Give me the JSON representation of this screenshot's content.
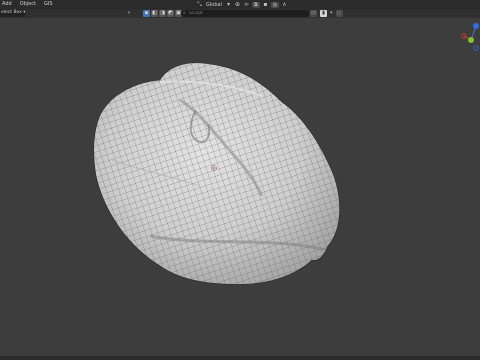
{
  "menubar": {
    "items": [
      "Add",
      "Object",
      "GIS"
    ]
  },
  "header": {
    "pivot_label": "Global",
    "snap_dropdown": "▾"
  },
  "toolbar": {
    "select_mode_label": "elect Box ▾",
    "collapse_glyph": "«",
    "search_placeholder": "Sculpt"
  },
  "gizmo": {
    "axes": [
      {
        "name": "Z",
        "color": "#2f6fe0"
      },
      {
        "name": "X",
        "color": "#e0362f"
      },
      {
        "name": "Y",
        "color": "#86c234"
      }
    ]
  },
  "colors": {
    "background": "#3d3d3d",
    "menubar": "#2b2b2b",
    "active_tool": "#4772b3",
    "mesh": "#d9d9d9",
    "wire": "#5a5a5a"
  }
}
